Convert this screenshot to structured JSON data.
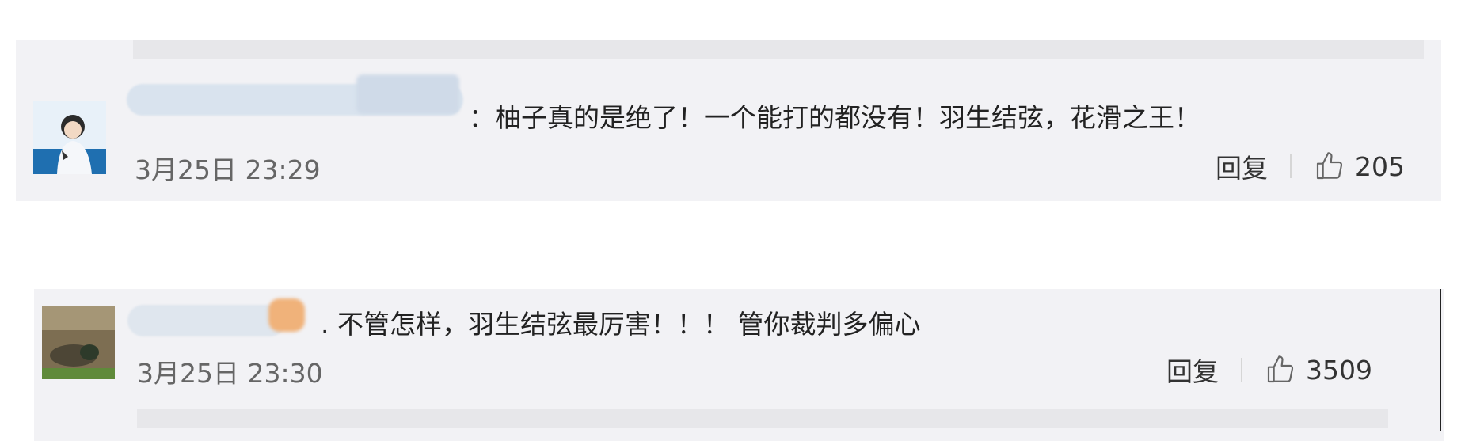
{
  "comments": [
    {
      "text": "：柚子真的是绝了！一个能打的都没有！羽生结弦，花滑之王！",
      "time": "3月25日 23:29",
      "reply_label": "回复",
      "likes": "205"
    },
    {
      "text": ". 不管怎样，羽生结弦最厉害！！！ 管你裁判多偏心",
      "time": "3月25日 23:30",
      "reply_label": "回复",
      "likes": "3509"
    }
  ],
  "icons": {
    "like": "thumbs-up-icon"
  }
}
